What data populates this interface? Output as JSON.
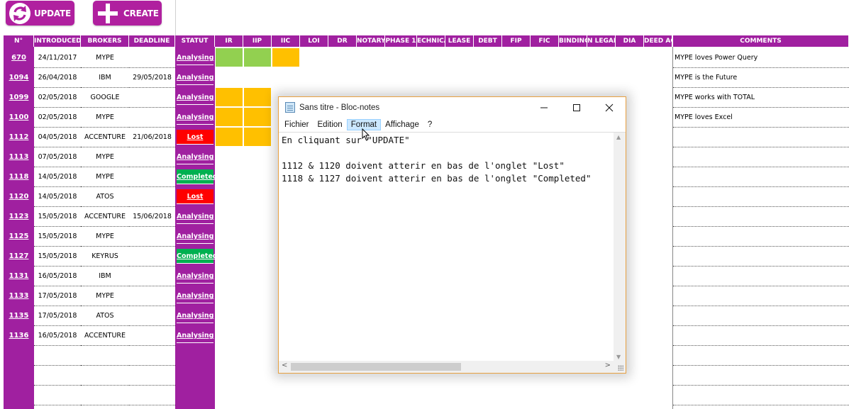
{
  "toolbar": {
    "update_label": "UPDATE",
    "create_label": "CREATE"
  },
  "headers": [
    "N°",
    "INTRODUCED",
    "BROKERS",
    "DEADLINE",
    "STATUT",
    "IR",
    "IIP",
    "IIC",
    "LOI",
    "DR",
    "NOTARY",
    "PHASE 1",
    "ECHNICA",
    "LEASE",
    "DEBT",
    "FIP",
    "FIC",
    "BINDING",
    "N LEGAL",
    "DIA",
    "DEED ACT",
    "COMMENTS"
  ],
  "rows": [
    {
      "id": "670",
      "introduced": "24/11/2017",
      "broker": "MYPE",
      "deadline": "",
      "statut": "Analysing",
      "comment": "MYPE loves Power Query"
    },
    {
      "id": "1094",
      "introduced": "26/04/2018",
      "broker": "IBM",
      "deadline": "29/05/2018",
      "statut": "Analysing",
      "comment": "MYPE is the Future"
    },
    {
      "id": "1099",
      "introduced": "02/05/2018",
      "broker": "GOOGLE",
      "deadline": "",
      "statut": "Analysing",
      "comment": "MYPE works with TOTAL"
    },
    {
      "id": "1100",
      "introduced": "02/05/2018",
      "broker": "MYPE",
      "deadline": "",
      "statut": "Analysing",
      "comment": "MYPE loves Excel"
    },
    {
      "id": "1112",
      "introduced": "04/05/2018",
      "broker": "ACCENTURE",
      "deadline": "21/06/2018",
      "statut": "Lost",
      "comment": ""
    },
    {
      "id": "1113",
      "introduced": "07/05/2018",
      "broker": "MYPE",
      "deadline": "",
      "statut": "Analysing",
      "comment": ""
    },
    {
      "id": "1118",
      "introduced": "14/05/2018",
      "broker": "MYPE",
      "deadline": "",
      "statut": "Completed",
      "comment": ""
    },
    {
      "id": "1120",
      "introduced": "14/05/2018",
      "broker": "ATOS",
      "deadline": "",
      "statut": "Lost",
      "comment": ""
    },
    {
      "id": "1123",
      "introduced": "15/05/2018",
      "broker": "ACCENTURE",
      "deadline": "15/06/2018",
      "statut": "Analysing",
      "comment": ""
    },
    {
      "id": "1125",
      "introduced": "15/05/2018",
      "broker": "MYPE",
      "deadline": "",
      "statut": "Analysing",
      "comment": ""
    },
    {
      "id": "1127",
      "introduced": "15/05/2018",
      "broker": "KEYRUS",
      "deadline": "",
      "statut": "Completed",
      "comment": ""
    },
    {
      "id": "1131",
      "introduced": "16/05/2018",
      "broker": "IBM",
      "deadline": "",
      "statut": "Analysing",
      "comment": ""
    },
    {
      "id": "1133",
      "introduced": "17/05/2018",
      "broker": "MYPE",
      "deadline": "",
      "statut": "Analysing",
      "comment": ""
    },
    {
      "id": "1135",
      "introduced": "17/05/2018",
      "broker": "ATOS",
      "deadline": "",
      "statut": "Analysing",
      "comment": ""
    },
    {
      "id": "1136",
      "introduced": "16/05/2018",
      "broker": "ACCENTURE",
      "deadline": "",
      "statut": "Analysing",
      "comment": ""
    }
  ],
  "phase_cells": [
    {
      "row": 0,
      "col": "IR",
      "color": "#92d050"
    },
    {
      "row": 0,
      "col": "IIP",
      "color": "#92d050"
    },
    {
      "row": 0,
      "col": "IIC",
      "color": "#ffc000"
    },
    {
      "row": 2,
      "col": "IR",
      "color": "#ffc000"
    },
    {
      "row": 2,
      "col": "IIP",
      "color": "#ffc000"
    },
    {
      "row": 3,
      "col": "IR",
      "color": "#ffc000"
    },
    {
      "row": 3,
      "col": "IIP",
      "color": "#ffc000"
    },
    {
      "row": 4,
      "col": "IR",
      "color": "#ffc000"
    },
    {
      "row": 4,
      "col": "IIP",
      "color": "#ffc000"
    }
  ],
  "status_colors": {
    "Analysing": "#a020a0",
    "Lost": "#ff0000",
    "Completed": "#00b050"
  },
  "notepad": {
    "title": "Sans titre - Bloc-notes",
    "menus": [
      "Fichier",
      "Edition",
      "Format",
      "Affichage",
      "?"
    ],
    "active_menu": "Format",
    "text": "En cliquant sur \"UPDATE\"\n\n1112 & 1120 doivent atterir en bas de l'onglet \"Lost\"\n1118 & 1127 doivent atterir en bas de l'onglet \"Completed\""
  }
}
